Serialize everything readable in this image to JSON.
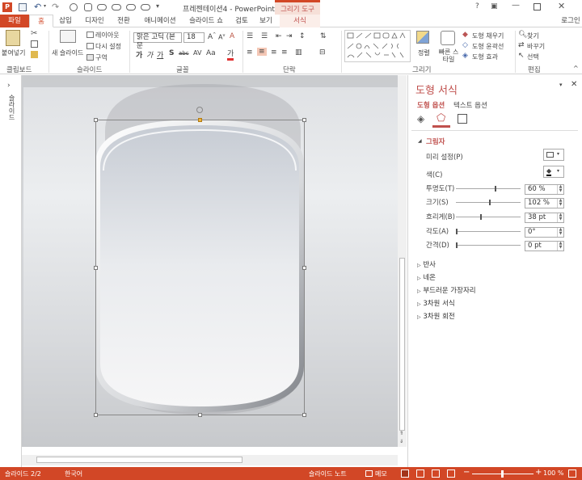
{
  "title": {
    "doc_title": "프레젠테이션4 - PowerPoint",
    "context_tool": "그리기 도구",
    "signin": "로그인"
  },
  "tabs": [
    "파일",
    "홈",
    "삽입",
    "디자인",
    "전환",
    "애니메이션",
    "슬라이드 쇼",
    "검토",
    "보기",
    "서식"
  ],
  "ribbon": {
    "clipboard": {
      "paste": "붙여넣기",
      "group": "클립보드"
    },
    "slides": {
      "new_slide": "새 슬라이드",
      "layout": "레이아웃",
      "reset": "다시 설정",
      "section": "구역",
      "group": "슬라이드"
    },
    "font": {
      "font_name": "맑은 고딕 (본문",
      "font_size": "18",
      "group": "글꼴"
    },
    "paragraph": {
      "group": "단락"
    },
    "drawing": {
      "arrange": "정렬",
      "quick_styles": "빠른 스타일",
      "fill": "도형 채우기",
      "outline": "도형 윤곽선",
      "effects": "도형 효과",
      "group": "그리기"
    },
    "editing": {
      "find": "찾기",
      "replace": "바꾸기",
      "select": "선택",
      "group": "편집"
    }
  },
  "left_pane": {
    "label": "슬라이드"
  },
  "format_pane": {
    "title": "도형 서식",
    "tab_shape": "도형 옵션",
    "tab_text": "텍스트 옵션",
    "shadow_section": "그림자",
    "preset_label": "미리 설정(P)",
    "color_label": "색(C)",
    "fields": [
      {
        "label": "투명도(T)",
        "value": "60 %",
        "level": 0.6
      },
      {
        "label": "크기(S)",
        "value": "102 %",
        "level": 0.51
      },
      {
        "label": "흐리게(B)",
        "value": "38 pt",
        "level": 0.38
      },
      {
        "label": "각도(A)",
        "value": "0°",
        "level": 0
      },
      {
        "label": "간격(D)",
        "value": "0 pt",
        "level": 0
      }
    ],
    "collapsed_sections": [
      "반사",
      "네온",
      "부드러운 가장자리",
      "3차원 서식",
      "3차원 회전"
    ]
  },
  "status": {
    "slide": "슬라이드 2/2",
    "lang": "한국어",
    "notes": "슬라이드 노트",
    "comments": "메모",
    "zoom": "100 %"
  },
  "colors": {
    "accent": "#d24726",
    "pane_title": "#c0504d"
  }
}
